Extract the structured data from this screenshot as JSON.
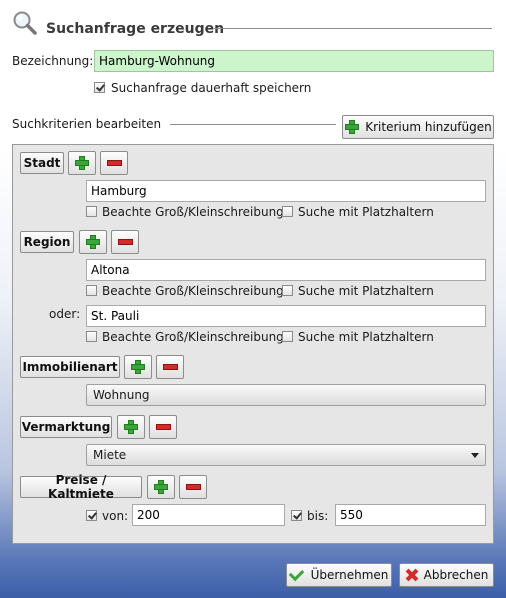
{
  "header": {
    "title": "Suchanfrage erzeugen"
  },
  "name_field": {
    "label": "Bezeichnung:",
    "value": "Hamburg-Wohnung"
  },
  "save_option": {
    "label": "Suchanfrage dauerhaft speichern",
    "checked": true
  },
  "criteria": {
    "title": "Suchkriterien bearbeiten",
    "add_button": "Kriterium hinzufügen",
    "stadt": {
      "label": "Stadt",
      "value": "Hamburg",
      "case_label": "Beachte Groß/Kleinschreibung",
      "wildcard_label": "Suche mit Platzhaltern"
    },
    "region": {
      "label": "Region",
      "value1": "Altona",
      "or_label": "oder:",
      "value2": "St. Pauli",
      "case_label": "Beachte Groß/Kleinschreibung",
      "wildcard_label": "Suche mit Platzhaltern"
    },
    "immobilienart": {
      "label": "Immobilienart",
      "value": "Wohnung"
    },
    "vermarktung": {
      "label": "Vermarktung",
      "value": "Miete"
    },
    "preise": {
      "label": "Preise / Kaltmiete",
      "from_label": "von:",
      "from_value": "200",
      "to_label": "bis:",
      "to_value": "550"
    }
  },
  "footer": {
    "ok_label": "Übernehmen",
    "cancel_label": "Abbrechen"
  }
}
